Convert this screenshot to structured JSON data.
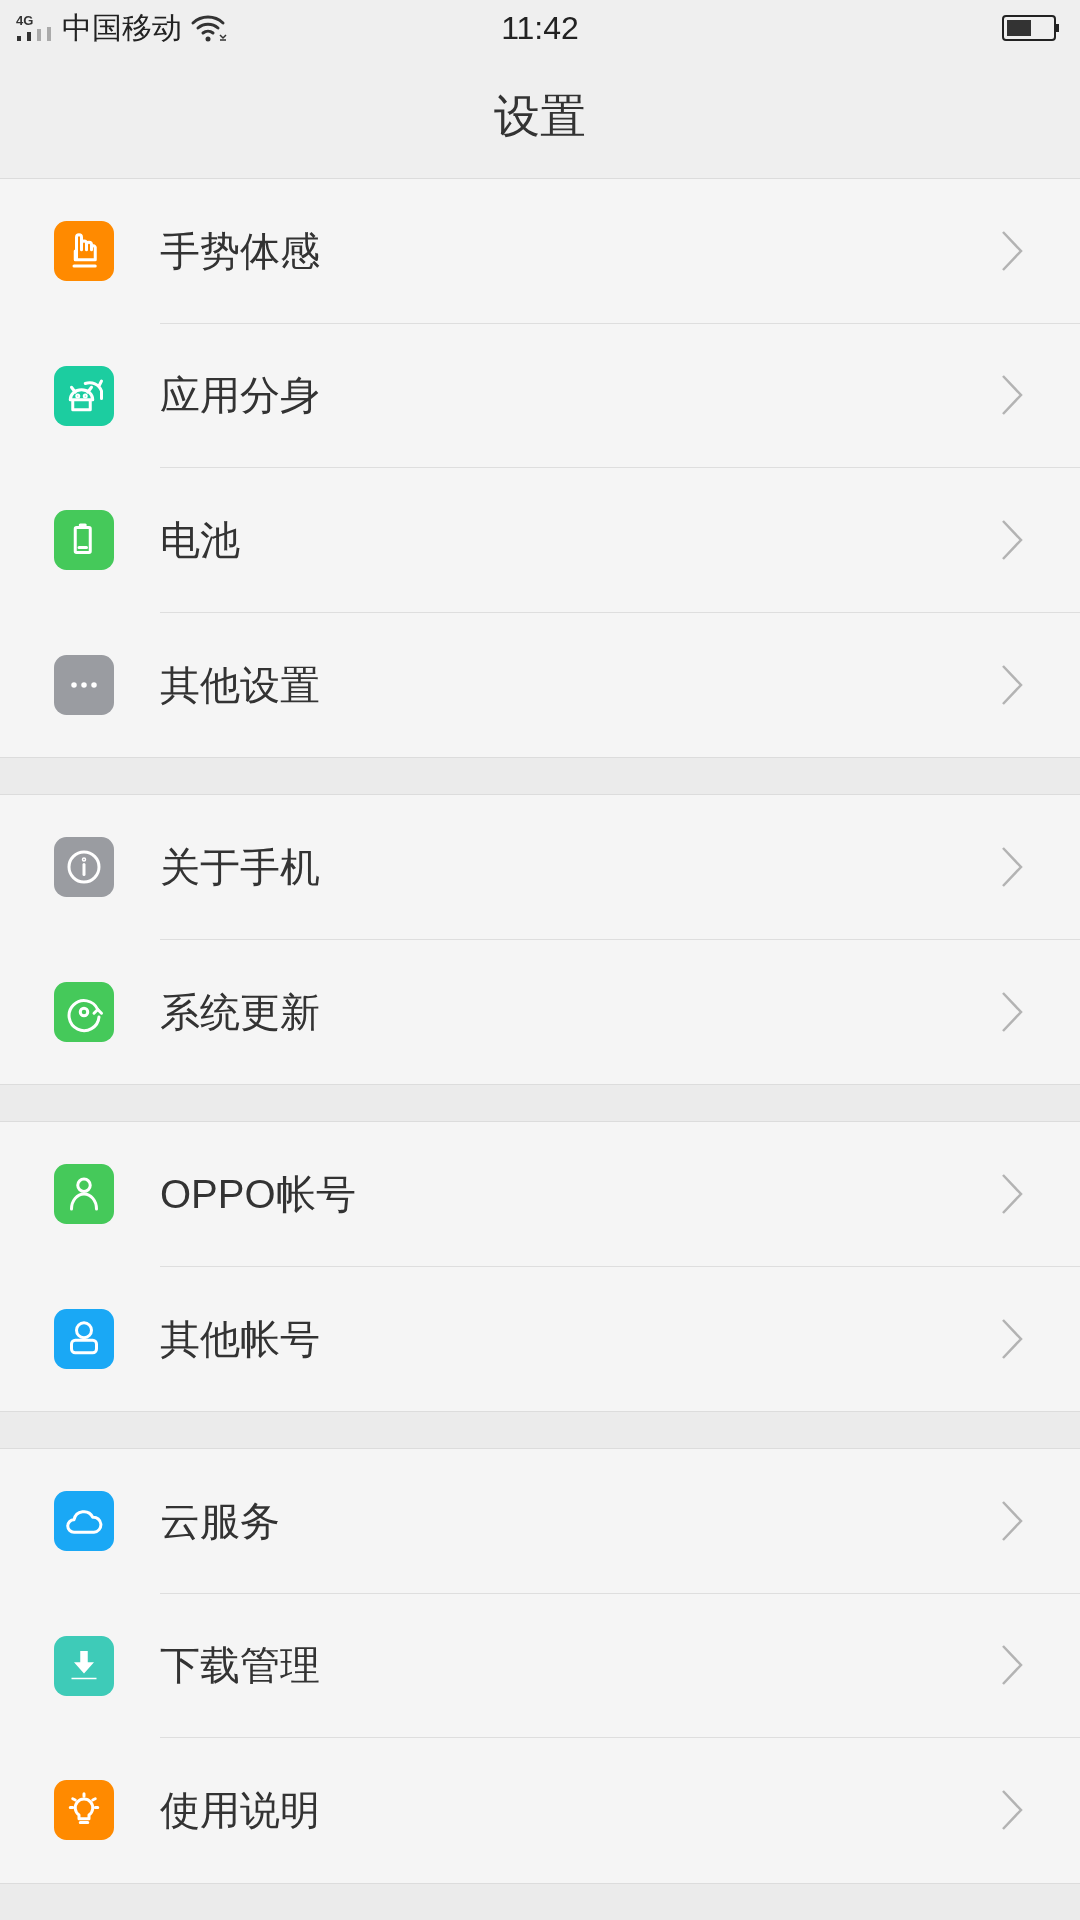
{
  "status_bar": {
    "network": "4G",
    "carrier": "中国移动",
    "time": "11:42"
  },
  "title": "设置",
  "groups": [
    {
      "items": [
        {
          "label": "手势体感",
          "kind": "hand",
          "color": "#ff8a00"
        },
        {
          "label": "应用分身",
          "kind": "android",
          "color": "#1ccda0"
        },
        {
          "label": "电池",
          "kind": "battery",
          "color": "#45c95a"
        },
        {
          "label": "其他设置",
          "kind": "dots",
          "color": "#9a9ca1"
        }
      ]
    },
    {
      "items": [
        {
          "label": "关于手机",
          "kind": "info",
          "color": "#9a9ca1"
        },
        {
          "label": "系统更新",
          "kind": "update",
          "color": "#45c95a"
        }
      ]
    },
    {
      "items": [
        {
          "label": "OPPO帐号",
          "kind": "person",
          "color": "#45c95a"
        },
        {
          "label": "其他帐号",
          "kind": "user",
          "color": "#1aa8f5"
        }
      ]
    },
    {
      "items": [
        {
          "label": "云服务",
          "kind": "cloud",
          "color": "#1aa8f5"
        },
        {
          "label": "下载管理",
          "kind": "download",
          "color": "#3ecbb8"
        },
        {
          "label": "使用说明",
          "kind": "bulb",
          "color": "#ff8a00"
        }
      ]
    }
  ]
}
